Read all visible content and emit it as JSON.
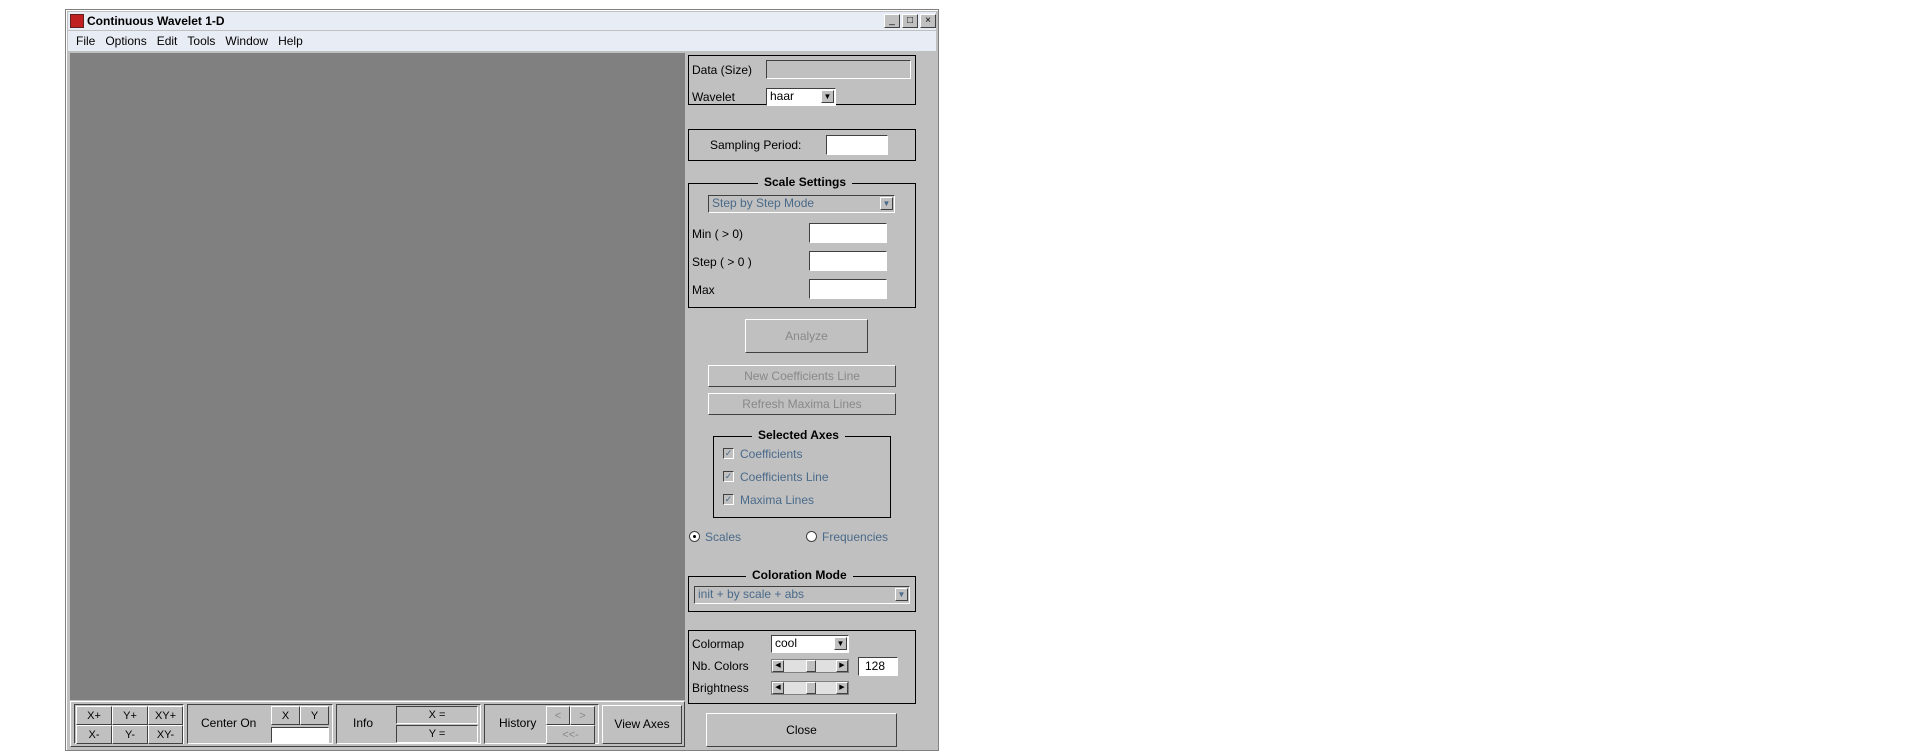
{
  "window": {
    "title": "Continuous Wavelet 1-D",
    "controls": [
      "_",
      "□",
      "×"
    ]
  },
  "menu": [
    "File",
    "Options",
    "Edit",
    "Tools",
    "Window",
    "Help"
  ],
  "data_frame": {
    "data_label": "Data  (Size)",
    "wavelet_label": "Wavelet",
    "wavelet_value": "haar"
  },
  "sampling": {
    "label": "Sampling Period:"
  },
  "scale_settings": {
    "title": "Scale Settings",
    "mode": "Step by Step Mode",
    "min_label": "Min  ( > 0)",
    "step_label": "Step ( > 0 )",
    "max_label": "Max"
  },
  "buttons": {
    "analyze": "Analyze",
    "new_coef_line": "New Coefficients Line",
    "refresh_maxima": "Refresh Maxima Lines",
    "close": "Close"
  },
  "selected_axes": {
    "title": "Selected Axes",
    "items": [
      "Coefficients",
      "Coefficients Line",
      "Maxima Lines"
    ]
  },
  "radios": {
    "scales": "Scales",
    "frequencies": "Frequencies",
    "selected": "scales"
  },
  "coloration": {
    "title": "Coloration Mode",
    "value": "init + by scale + abs"
  },
  "colormap": {
    "colormap_label": "Colormap",
    "colormap_value": "cool",
    "nbcolors_label": "Nb. Colors",
    "nbcolors_value": "128",
    "brightness_label": "Brightness"
  },
  "bottom": {
    "zoom": [
      "X+",
      "Y+",
      "XY+",
      "X-",
      "Y-",
      "XY-"
    ],
    "center_on": "Center On",
    "x": "X",
    "y": "Y",
    "info": "Info",
    "x_eq": "X =",
    "y_eq": "Y =",
    "history": "History",
    "hist_prev": "<",
    "hist_next": ">",
    "hist_first": "<<-",
    "view_axes": "View Axes"
  }
}
